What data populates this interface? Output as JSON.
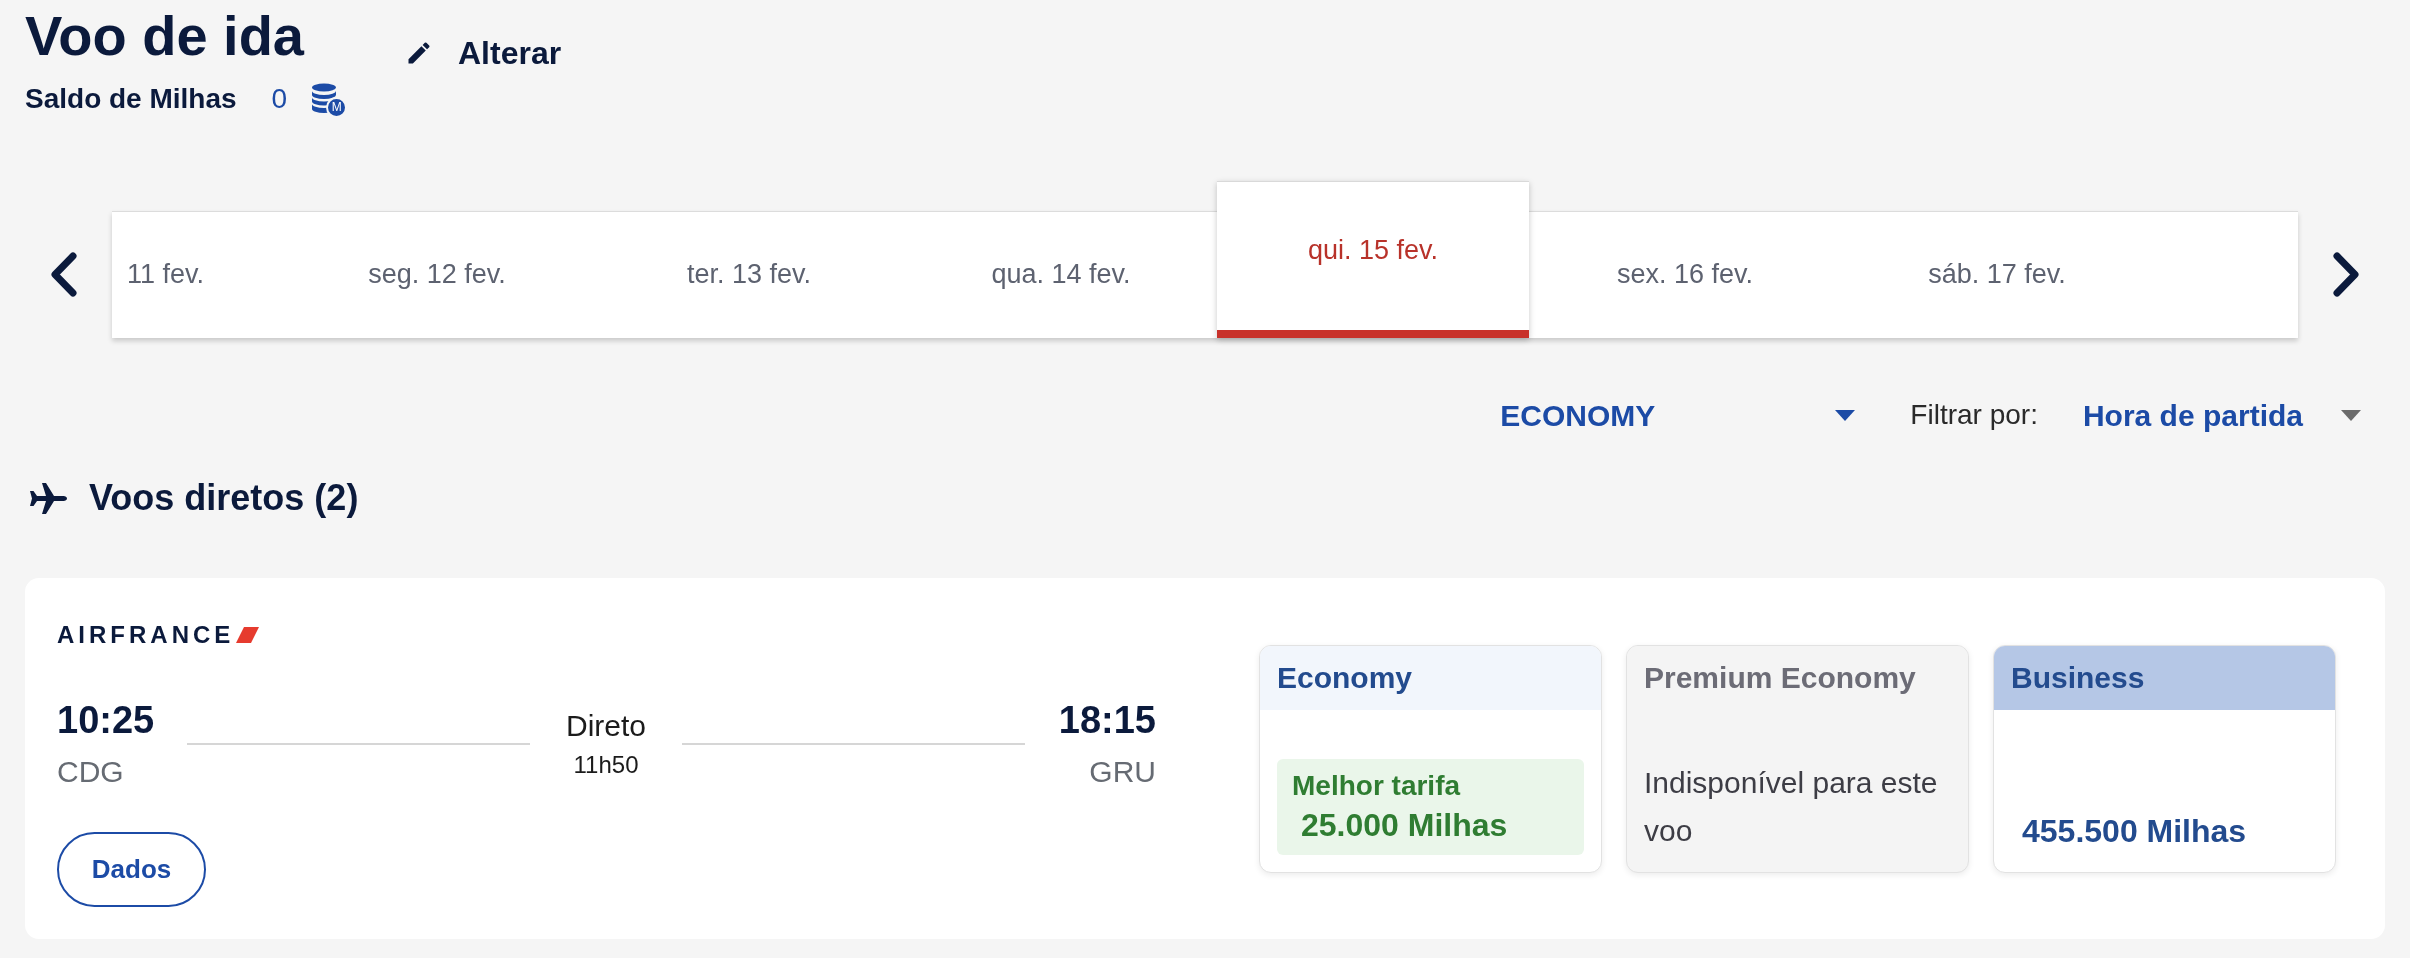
{
  "header": {
    "title": "Voo de ida",
    "balance": {
      "label": "Saldo de Milhas",
      "value": "0",
      "badge": "M"
    },
    "edit_button": {
      "label": "Alterar"
    }
  },
  "date_strip": {
    "dates": [
      {
        "label": "11 fev.",
        "selected": false
      },
      {
        "label": "seg. 12 fev.",
        "selected": false
      },
      {
        "label": "ter. 13 fev.",
        "selected": false
      },
      {
        "label": "qua. 14 fev.",
        "selected": false
      },
      {
        "label": "qui. 15 fev.",
        "selected": true
      },
      {
        "label": "sex. 16 fev.",
        "selected": false
      },
      {
        "label": "sáb. 17 fev.",
        "selected": false
      }
    ]
  },
  "filters": {
    "cabin": {
      "value": "ECONOMY"
    },
    "sort": {
      "label": "Filtrar por:",
      "value": "Hora de partida"
    }
  },
  "section": {
    "title": "Voos diretos (2)"
  },
  "flights": [
    {
      "airline": "AIRFRANCE",
      "departure": {
        "time": "10:25",
        "airport": "CDG"
      },
      "stop_type": "Direto",
      "duration": "11h50",
      "arrival": {
        "time": "18:15",
        "airport": "GRU"
      },
      "details_button": "Dados",
      "fares": [
        {
          "cabin": "Economy",
          "kind": "best",
          "badge": "Melhor tarifa",
          "price": "25.000 Milhas"
        },
        {
          "cabin": "Premium Economy",
          "kind": "unavailable",
          "message": "Indisponível para este voo"
        },
        {
          "cabin": "Business",
          "kind": "available",
          "price": "455.500 Milhas"
        }
      ]
    }
  ]
}
